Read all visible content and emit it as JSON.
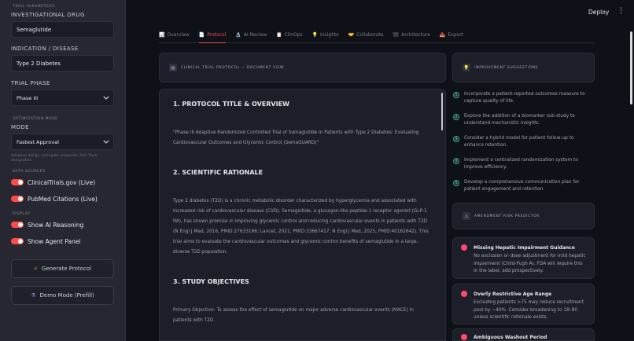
{
  "sidebar": {
    "section_trial": "TRIAL PARAMETERS",
    "drug_label": "INVESTIGATIONAL DRUG",
    "drug_value": "Semaglutide",
    "disease_label": "INDICATION / DISEASE",
    "disease_value": "Type 2 Diabetes",
    "phase_label": "TRIAL PHASE",
    "phase_value": "Phase III",
    "section_optimization": "OPTIMIZATION MODE",
    "mode_label": "MODE",
    "mode_value": "Fastest Approval",
    "mode_help": "Adaptive design, surrogate endpoints, Fast Track designation",
    "section_data": "DATA SOURCES",
    "toggle_ct": "ClinicalTrials.gov (Live)",
    "toggle_pubmed": "PubMed Citations (Live)",
    "section_display": "DISPLAY",
    "toggle_reasoning": "Show AI Reasoning",
    "toggle_agent": "Show Agent Panel",
    "generate_btn": "Generate Protocol",
    "demo_btn": "Demo Mode (Prefill)"
  },
  "header": {
    "deploy": "Deploy",
    "menu": "⋮"
  },
  "tabs": [
    {
      "icon": "📊",
      "label": "Overview"
    },
    {
      "icon": "📄",
      "label": "Protocol"
    },
    {
      "icon": "🔬",
      "label": "AI Review"
    },
    {
      "icon": "📋",
      "label": "ClinOps"
    },
    {
      "icon": "💡",
      "label": "Insights"
    },
    {
      "icon": "🤝",
      "label": "Collaborate"
    },
    {
      "icon": "🏗",
      "label": "Architecture"
    },
    {
      "icon": "📤",
      "label": "Export"
    }
  ],
  "doc": {
    "header": "CLINICAL TRIAL PROTOCOL — DOCUMENT VIEW",
    "h1": "1. PROTOCOL TITLE & OVERVIEW",
    "p1": "\"Phase III Adaptive Randomized Controlled Trial of Semaglutide in Patients with Type 2 Diabetes: Evaluating Cardiovascular Outcomes and Glycemic Control (SemaGUARD)\"",
    "h2": "2. SCIENTIFIC RATIONALE",
    "p2": "Type 2 diabetes (T2D) is a chronic metabolic disorder characterized by hyperglycemia and associated with increased risk of cardiovascular disease (CVD). Semaglutide, a glucagon-like peptide-1 receptor agonist (GLP-1 RA), has shown promise in improving glycemic control and reducing cardiovascular events in patients with T2D (N Engl J Med, 2016, PMID:27633186; Lancet, 2021, PMID:33667417; N Engl J Med, 2025, PMID:40162642). This trial aims to evaluate the cardiovascular outcomes and glycemic control benefits of semaglutide in a large, diverse T2D population.",
    "h3": "3. STUDY OBJECTIVES",
    "p3": "Primary Objective: To assess the effect of semaglutide on major adverse cardiovascular events (MACE) in patients with T2D."
  },
  "suggestions": {
    "header": "IMPROVEMENT SUGGESTIONS",
    "items": [
      {
        "n": "1",
        "text": "Incorporate a patient-reported outcomes measure to capture quality of life."
      },
      {
        "n": "2",
        "text": "Explore the addition of a biomarker sub-study to understand mechanistic insights."
      },
      {
        "n": "3",
        "text": "Consider a hybrid model for patient follow-up to enhance retention."
      },
      {
        "n": "4",
        "text": "Implement a centralized randomization system to improve efficiency."
      },
      {
        "n": "5",
        "text": "Develop a comprehensive communication plan for patient engagement and retention."
      }
    ]
  },
  "risk": {
    "header": "AMENDMENT RISK PREDICTOR",
    "items": [
      {
        "title": "Missing Hepatic Impairment Guidance",
        "desc": "No exclusion or dose adjustment for mild hepatic impairment (Child-Pugh A). FDA will require this in the label; add prospectively."
      },
      {
        "title": "Overly Restrictive Age Range",
        "desc": "Excluding patients >75 may reduce recruitment pool by ~40%. Consider broadening to 18–80 unless scientific rationale exists."
      },
      {
        "title": "Ambiguous Washout Period",
        "desc": ""
      }
    ]
  }
}
